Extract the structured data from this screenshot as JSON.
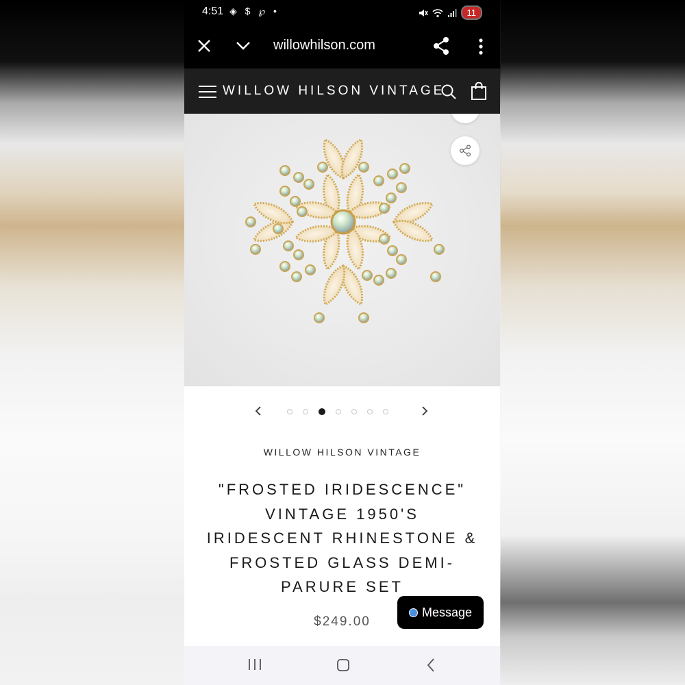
{
  "status_bar": {
    "time": "4:51",
    "left_icons": "◈ $ ℘ •",
    "battery": "11"
  },
  "browser": {
    "url": "willowhilson.com"
  },
  "site": {
    "logo": "WILLOW HILSON VINTAGE"
  },
  "gallery": {
    "dot_count": 7,
    "active_index": 2
  },
  "product": {
    "vendor": "WILLOW HILSON VINTAGE",
    "title": "\"FROSTED IRIDESCENCE\" VINTAGE 1950'S IRIDESCENT RHINESTONE & FROSTED GLASS DEMI-PARURE SET",
    "price": "$249.00",
    "image_alt": "Gold-tone brooch with frosted glass petals and iridescent rhinestones"
  },
  "chat": {
    "message_label": "Message"
  },
  "icons": {
    "close": "close-icon",
    "dropdown": "chevron-down-icon",
    "share": "share-icon",
    "more": "more-vert-icon",
    "menu": "hamburger-icon",
    "search": "search-icon",
    "cart": "shopping-bag-icon"
  }
}
